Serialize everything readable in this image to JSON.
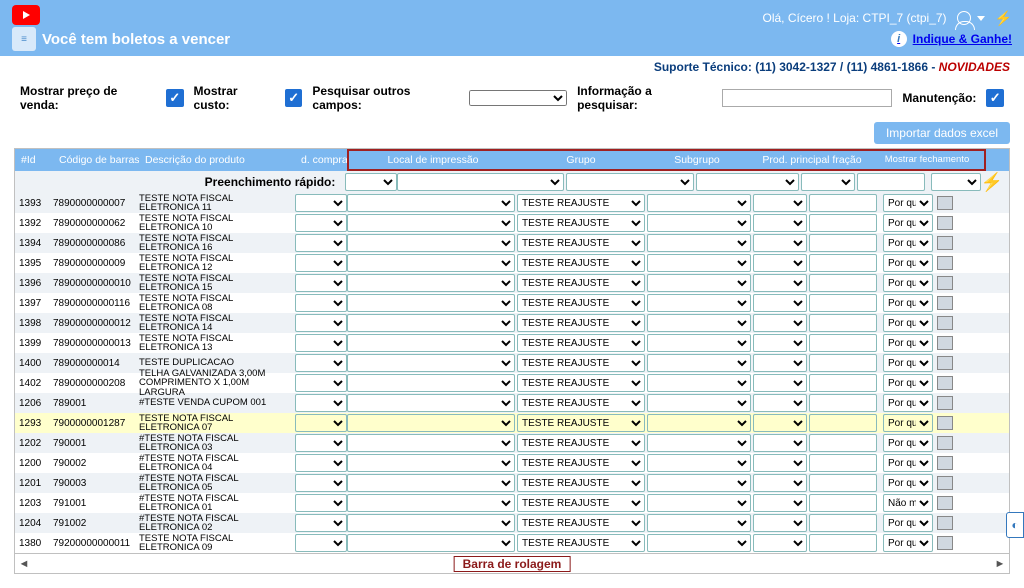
{
  "header": {
    "title": "Você tem boletos a vencer",
    "greeting": "Olá, Cícero ! Loja: CTPI_7 (ctpi_7)",
    "indique": "Indique & Ganhe!"
  },
  "support": {
    "text": "Suporte Técnico: (11) 3042-1327 / (11) 4861-1866 - ",
    "novidades": "NOVIDADES"
  },
  "filters": {
    "mostrar_preco": "Mostrar preço de venda:",
    "mostrar_custo": "Mostrar custo:",
    "pesquisar_outros": "Pesquisar outros campos:",
    "informacao": "Informação a pesquisar:",
    "manutencao": "Manutenção:"
  },
  "buttons": {
    "import": "Importar dados excel"
  },
  "columns": {
    "id": "#Id",
    "barcode": "Código de barras",
    "desc": "Descrição do produto",
    "dcompra": "d. compra",
    "local": "Local de impressão",
    "grupo": "Grupo",
    "subgrupo": "Subgrupo",
    "prod": "Prod. principal fração",
    "mostrar": "Mostrar fechamento"
  },
  "quick_label": "Preenchimento rápido:",
  "scroll_label": "Barra de rolagem",
  "rows": [
    {
      "id": "1393",
      "barcode": "7890000000007",
      "desc": "TESTE NOTA FISCAL ELETRONICA 11",
      "grupo": "TESTE REAJUSTE",
      "most": "Por quant",
      "hl": false
    },
    {
      "id": "1392",
      "barcode": "7890000000062",
      "desc": "TESTE NOTA FISCAL ELETRONICA 10",
      "grupo": "TESTE REAJUSTE",
      "most": "Por quant",
      "hl": false
    },
    {
      "id": "1394",
      "barcode": "7890000000086",
      "desc": "TESTE NOTA FISCAL ELETRONICA 16",
      "grupo": "TESTE REAJUSTE",
      "most": "Por quant",
      "hl": false
    },
    {
      "id": "1395",
      "barcode": "7890000000009",
      "desc": "TESTE NOTA FISCAL ELETRONICA 12",
      "grupo": "TESTE REAJUSTE",
      "most": "Por quant",
      "hl": false
    },
    {
      "id": "1396",
      "barcode": "78900000000010",
      "desc": "TESTE NOTA FISCAL ELETRONICA 15",
      "grupo": "TESTE REAJUSTE",
      "most": "Por quant",
      "hl": false
    },
    {
      "id": "1397",
      "barcode": "78900000000116",
      "desc": "TESTE NOTA FISCAL ELETRONICA 08",
      "grupo": "TESTE REAJUSTE",
      "most": "Por quant",
      "hl": false
    },
    {
      "id": "1398",
      "barcode": "78900000000012",
      "desc": "TESTE NOTA FISCAL ELETRONICA 14",
      "grupo": "TESTE REAJUSTE",
      "most": "Por quant",
      "hl": false
    },
    {
      "id": "1399",
      "barcode": "78900000000013",
      "desc": "TESTE NOTA FISCAL ELETRONICA 13",
      "grupo": "TESTE REAJUSTE",
      "most": "Por quant",
      "hl": false
    },
    {
      "id": "1400",
      "barcode": "789000000014",
      "desc": "TESTE DUPLICACAO",
      "grupo": "TESTE REAJUSTE",
      "most": "Por quant",
      "hl": false
    },
    {
      "id": "1402",
      "barcode": "7890000000208",
      "desc": "TELHA GALVANIZADA 3,00M COMPRIMENTO X 1,00M LARGURA",
      "grupo": "TESTE REAJUSTE",
      "most": "Por quant",
      "hl": false
    },
    {
      "id": "1206",
      "barcode": "789001",
      "desc": "#TESTE VENDA CUPOM 001",
      "grupo": "TESTE REAJUSTE",
      "most": "Por quant",
      "hl": false
    },
    {
      "id": "1293",
      "barcode": "7900000001287",
      "desc": "TESTE NOTA FISCAL ELETRONICA 07",
      "grupo": "TESTE REAJUSTE",
      "most": "Por quant",
      "hl": true
    },
    {
      "id": "1202",
      "barcode": "790001",
      "desc": "#TESTE NOTA FISCAL ELETRONICA 03",
      "grupo": "TESTE REAJUSTE",
      "most": "Por quant",
      "hl": false
    },
    {
      "id": "1200",
      "barcode": "790002",
      "desc": "#TESTE NOTA FISCAL ELETRONICA 04",
      "grupo": "TESTE REAJUSTE",
      "most": "Por quant",
      "hl": false
    },
    {
      "id": "1201",
      "barcode": "790003",
      "desc": "#TESTE NOTA FISCAL ELETRONICA 05",
      "grupo": "TESTE REAJUSTE",
      "most": "Por quant",
      "hl": false
    },
    {
      "id": "1203",
      "barcode": "791001",
      "desc": "#TESTE NOTA FISCAL ELETRONICA 01",
      "grupo": "TESTE REAJUSTE",
      "most": "Não most",
      "hl": false
    },
    {
      "id": "1204",
      "barcode": "791002",
      "desc": "#TESTE NOTA FISCAL ELETRONICA 02",
      "grupo": "TESTE REAJUSTE",
      "most": "Por quant",
      "hl": false
    },
    {
      "id": "1380",
      "barcode": "79200000000011",
      "desc": "TESTE NOTA FISCAL ELETRONICA 09",
      "grupo": "TESTE REAJUSTE",
      "most": "Por quant",
      "hl": false
    }
  ]
}
